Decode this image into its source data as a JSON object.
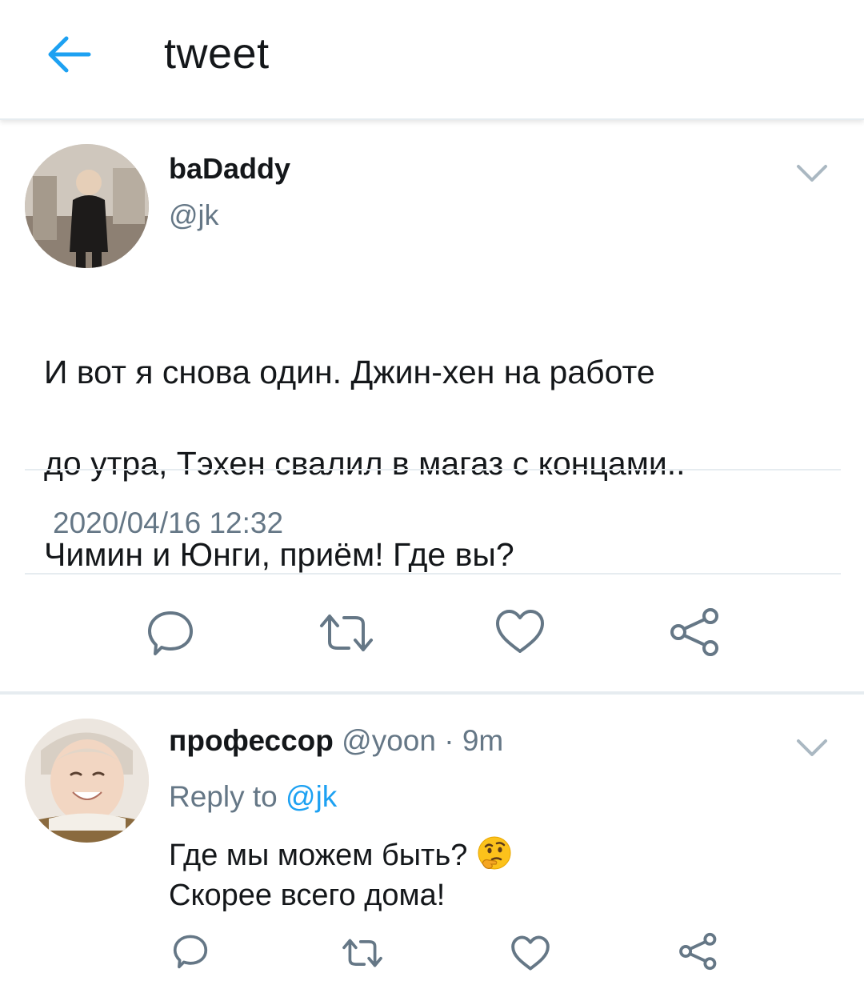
{
  "header": {
    "title": "tweet",
    "back_icon": "arrow-left-icon"
  },
  "tweet": {
    "author_name": "baDaddy",
    "author_handle": "@jk",
    "text_lines": [
      "И вот я снова один. Джин-хен на работе",
      "до утра, Тэхен свалил в магаз с концами..",
      "Чимин и Юнги, приём! Где вы?"
    ],
    "timestamp": "2020/04/16 12:32",
    "actions": [
      "reply-icon",
      "retweet-icon",
      "like-icon",
      "share-icon"
    ]
  },
  "reply": {
    "author_name": "профессор",
    "author_handle": "@yoon",
    "separator": "·",
    "time": "9m",
    "reply_to_label": "Reply to",
    "reply_to_handle": "@jk",
    "text_line1": "Где мы можем быть?",
    "text_line2": "Скорее всего дома!",
    "emoji": "thinking-face-emoji",
    "actions": [
      "reply-icon",
      "retweet-icon",
      "like-icon",
      "share-icon"
    ]
  },
  "colors": {
    "accent": "#1da1f2",
    "text": "#14171a",
    "secondary_text": "#657786",
    "icon": "#657786",
    "divider": "#e6ecf0"
  }
}
